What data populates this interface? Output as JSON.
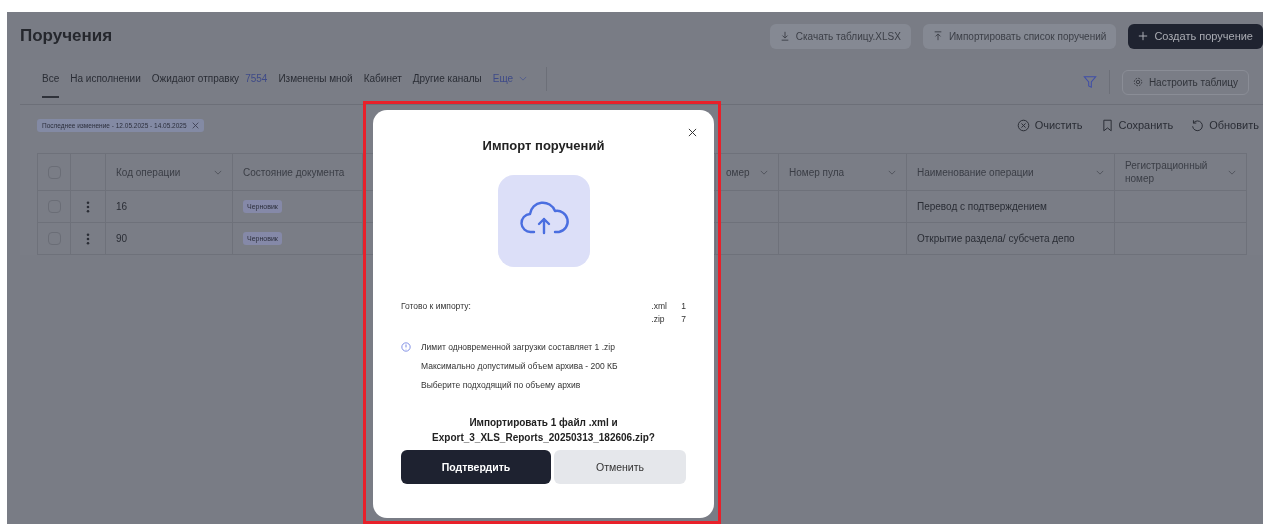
{
  "page": {
    "title": "Поручения"
  },
  "header_buttons": [
    {
      "kind": "download",
      "label": "Скачать таблицу.XLSX"
    },
    {
      "kind": "upload",
      "label": "Импортировать список поручений"
    },
    {
      "kind": "primary",
      "label": "Создать поручение"
    }
  ],
  "tabs": [
    {
      "label": "Все",
      "selected": true
    },
    {
      "label": "На исполнении",
      "selected": false
    },
    {
      "label": "Ожидают отправку",
      "count": "7554",
      "selected": false
    },
    {
      "label": "Изменены мной",
      "selected": false
    },
    {
      "label": "Кабинет",
      "selected": false
    },
    {
      "label": "Другие каналы",
      "selected": false
    }
  ],
  "more_tab": "Еще",
  "configure_button": "Настроить таблицу",
  "filter_chip": "Последнее изменение - 12.05.2025 - 14.05.2025",
  "actions": [
    {
      "kind": "clear",
      "label": "Очистить"
    },
    {
      "kind": "save",
      "label": "Сохранить"
    },
    {
      "kind": "refresh",
      "label": "Обновить"
    }
  ],
  "table": {
    "all_checked": false,
    "columns": [
      "Код операции",
      "Состояние документа",
      "",
      "омер",
      "Номер пула",
      "Наименование операции",
      "Регистрационный номер"
    ],
    "rows": [
      {
        "checked": false,
        "code": "16",
        "status": "Черновик",
        "name": "Перевод с подтверждением"
      },
      {
        "checked": false,
        "code": "90",
        "status": "Черновик",
        "name": "Открытие раздела/ субсчета депо"
      }
    ]
  },
  "dialog": {
    "title": "Импорт поручений",
    "ready_label": "Готово к импорту:",
    "files": [
      {
        "ext": ".xml",
        "count": "1"
      },
      {
        "ext": ".zip",
        "count": "7"
      }
    ],
    "notes": [
      "Лимит одновременной загрузки составляет 1 .zip",
      "Максимально допустимый объем архива - 200 КБ",
      "Выберите подходящий по объему архив"
    ],
    "question": [
      "Импортировать 1 файл .xml и",
      "Export_3_XLS_Reports_20250313_182606.zip?"
    ],
    "confirm": "Подтвердить",
    "cancel": "Отменить"
  }
}
